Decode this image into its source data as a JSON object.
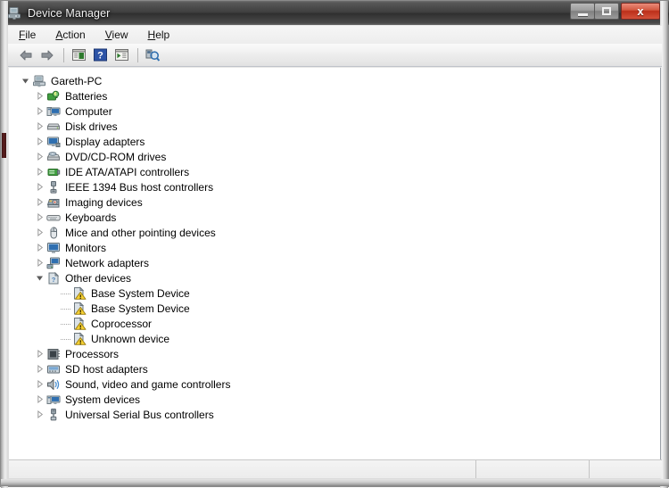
{
  "window": {
    "title": "Device Manager",
    "icon": "device-manager-icon",
    "controls": {
      "minimize": "minimize-button",
      "maximize": "maximize-button",
      "close": "close-button",
      "close_glyph": "x",
      "close_color": "#bc2f1a"
    }
  },
  "menubar": {
    "items": [
      {
        "label": "File",
        "accel": "F"
      },
      {
        "label": "Action",
        "accel": "A"
      },
      {
        "label": "View",
        "accel": "V"
      },
      {
        "label": "Help",
        "accel": "H"
      }
    ]
  },
  "toolbar": {
    "buttons": [
      {
        "name": "back-button",
        "icon": "arrow-left-icon"
      },
      {
        "name": "forward-button",
        "icon": "arrow-right-icon"
      },
      {
        "name": "show-hide-console-tree-button",
        "icon": "console-tree-icon"
      },
      {
        "name": "help-button",
        "icon": "question-mark-icon"
      },
      {
        "name": "properties-button",
        "icon": "properties-icon"
      },
      {
        "name": "scan-for-hardware-changes-button",
        "icon": "scan-hardware-icon"
      }
    ]
  },
  "tree": {
    "root": {
      "label": "Gareth-PC",
      "icon": "computer-root-icon",
      "expanded": true
    },
    "nodes": [
      {
        "label": "Batteries",
        "icon": "battery-icon",
        "expanded": false,
        "level": 1
      },
      {
        "label": "Computer",
        "icon": "computer-icon",
        "expanded": false,
        "level": 1
      },
      {
        "label": "Disk drives",
        "icon": "disk-drive-icon",
        "expanded": false,
        "level": 1
      },
      {
        "label": "Display adapters",
        "icon": "display-icon",
        "expanded": false,
        "level": 1
      },
      {
        "label": "DVD/CD-ROM drives",
        "icon": "dvd-drive-icon",
        "expanded": false,
        "level": 1
      },
      {
        "label": "IDE ATA/ATAPI controllers",
        "icon": "ide-controller-icon",
        "expanded": false,
        "level": 1
      },
      {
        "label": "IEEE 1394 Bus host controllers",
        "icon": "firewire-icon",
        "expanded": false,
        "level": 1
      },
      {
        "label": "Imaging devices",
        "icon": "camera-icon",
        "expanded": false,
        "level": 1
      },
      {
        "label": "Keyboards",
        "icon": "keyboard-icon",
        "expanded": false,
        "level": 1
      },
      {
        "label": "Mice and other pointing devices",
        "icon": "mouse-icon",
        "expanded": false,
        "level": 1
      },
      {
        "label": "Monitors",
        "icon": "monitor-icon",
        "expanded": false,
        "level": 1
      },
      {
        "label": "Network adapters",
        "icon": "network-icon",
        "expanded": false,
        "level": 1
      },
      {
        "label": "Other devices",
        "icon": "other-devices-icon",
        "expanded": true,
        "level": 1
      },
      {
        "label": "Base System Device",
        "icon": "unknown-device-warning-icon",
        "expanded": null,
        "level": 2
      },
      {
        "label": "Base System Device",
        "icon": "unknown-device-warning-icon",
        "expanded": null,
        "level": 2
      },
      {
        "label": "Coprocessor",
        "icon": "unknown-device-warning-icon",
        "expanded": null,
        "level": 2
      },
      {
        "label": "Unknown device",
        "icon": "unknown-device-warning-icon",
        "expanded": null,
        "level": 2
      },
      {
        "label": "Processors",
        "icon": "processor-icon",
        "expanded": false,
        "level": 1
      },
      {
        "label": "SD host adapters",
        "icon": "sd-adapter-icon",
        "expanded": false,
        "level": 1
      },
      {
        "label": "Sound, video and game controllers",
        "icon": "speaker-icon",
        "expanded": false,
        "level": 1
      },
      {
        "label": "System devices",
        "icon": "system-device-icon",
        "expanded": false,
        "level": 1
      },
      {
        "label": "Universal Serial Bus controllers",
        "icon": "usb-icon",
        "expanded": false,
        "level": 1
      }
    ]
  },
  "statusbar": {
    "segments": [
      "",
      "",
      ""
    ]
  }
}
